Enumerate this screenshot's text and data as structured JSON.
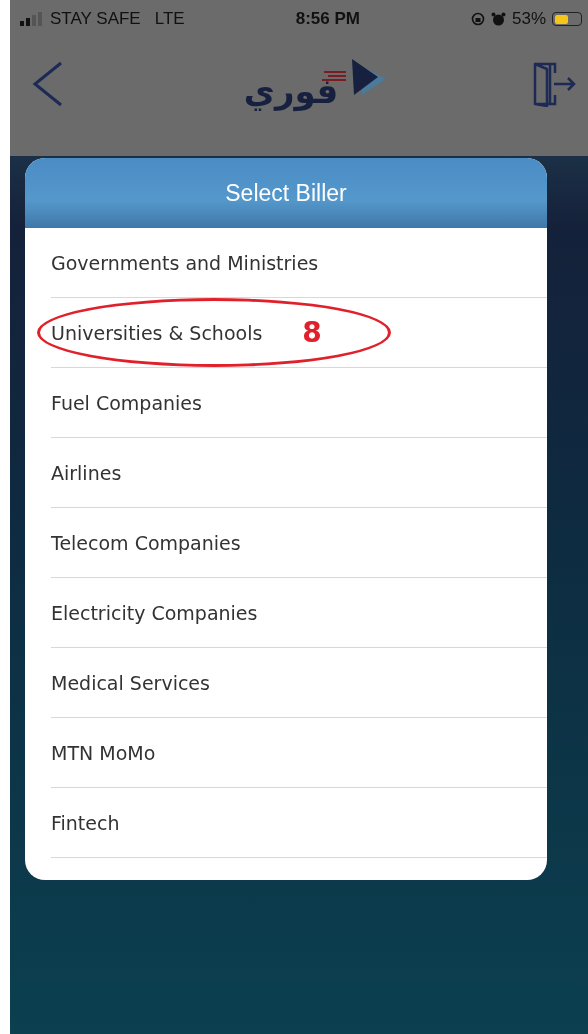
{
  "status_bar": {
    "carrier": "STAY SAFE",
    "network": "LTE",
    "time": "8:56 PM",
    "battery_text": "53%"
  },
  "header": {
    "logo_text": "فوري"
  },
  "dialog": {
    "title": "Select Biller",
    "items": [
      {
        "label": "Governments and Ministries"
      },
      {
        "label": "Universities & Schools",
        "annotation": "8"
      },
      {
        "label": "Fuel Companies"
      },
      {
        "label": "Airlines"
      },
      {
        "label": "Telecom Companies"
      },
      {
        "label": "Electricity Companies"
      },
      {
        "label": "Medical Services"
      },
      {
        "label": "MTN MoMo"
      },
      {
        "label": "Fintech"
      }
    ]
  }
}
